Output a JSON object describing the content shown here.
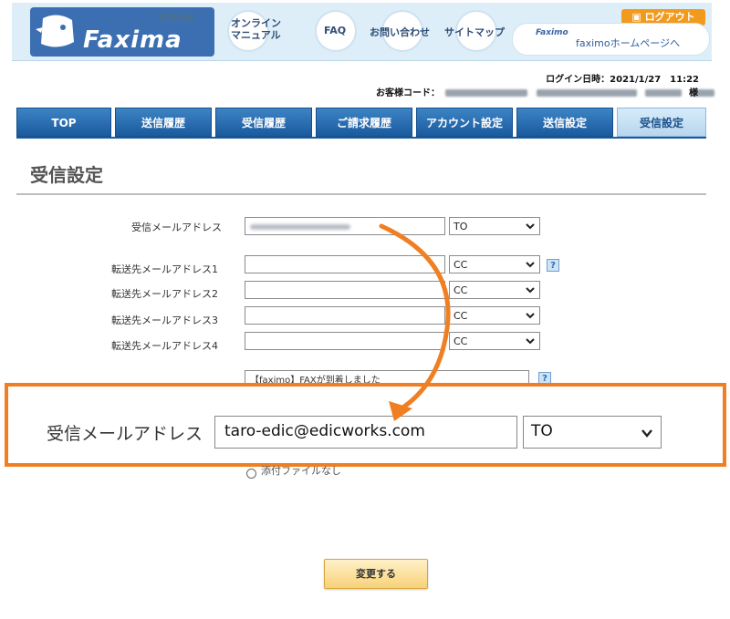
{
  "header": {
    "logo_text": "Faxima",
    "admin_label": "管理画面",
    "nav": [
      {
        "label": "オンライン\nマニュアル"
      },
      {
        "label": "FAQ"
      },
      {
        "label": "お問い合わせ"
      },
      {
        "label": "サイトマップ"
      }
    ],
    "logout_label": "ログアウト",
    "home_link": "faximoホームページへ",
    "mini_logo": "Faximo"
  },
  "login": {
    "login_time": "ログイン日時：2021/1/27　11:22",
    "customer_label": "お客様コード：",
    "customer_suffix": "様"
  },
  "tabs": [
    {
      "label": "TOP",
      "active": false
    },
    {
      "label": "送信履歴",
      "active": false
    },
    {
      "label": "受信履歴",
      "active": false
    },
    {
      "label": "ご請求履歴",
      "active": false
    },
    {
      "label": "アカウント設定",
      "active": false
    },
    {
      "label": "送信設定",
      "active": false
    },
    {
      "label": "受信設定",
      "active": true
    }
  ],
  "page_title": "受信設定",
  "form": {
    "receive_address": {
      "label": "受信メールアドレス",
      "type": "TO"
    },
    "forward": [
      {
        "label": "転送先メールアドレス1",
        "type": "CC"
      },
      {
        "label": "転送先メールアドレス2",
        "type": "CC"
      },
      {
        "label": "転送先メールアドレス3",
        "type": "CC"
      },
      {
        "label": "転送先メールアドレス4",
        "type": "CC"
      }
    ],
    "mail_title_value": "【faximo】FAXが到着しました"
  },
  "callout": {
    "label": "受信メールアドレス",
    "value": "taro-edic@edicworks.com",
    "type": "TO"
  },
  "attachment_option": "添付ファイルなし",
  "submit_label": "変更する",
  "colors": {
    "accent_orange": "#f07f23",
    "tab_blue": "#1a5a9e",
    "header_bg": "#ddeef9"
  }
}
